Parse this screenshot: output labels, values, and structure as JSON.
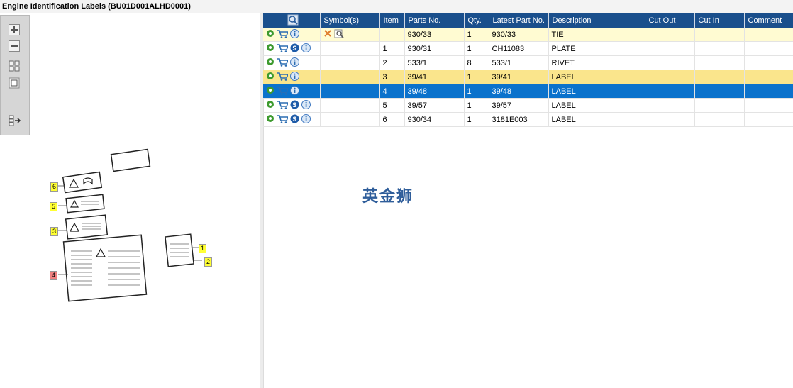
{
  "window": {
    "title": "Engine Identification Labels (BU01D001ALHD0001)"
  },
  "toolbar": {
    "tools": [
      "zoom-in-icon",
      "zoom-out-icon",
      "fit-all-icon",
      "fit-window-icon",
      "export-icon"
    ]
  },
  "drawing": {
    "callouts": [
      {
        "label": "6",
        "color": "yellow"
      },
      {
        "label": "5",
        "color": "yellow"
      },
      {
        "label": "3",
        "color": "yellow"
      },
      {
        "label": "4",
        "color": "red"
      },
      {
        "label": "1",
        "color": "yellow"
      },
      {
        "label": "2",
        "color": "yellow"
      }
    ]
  },
  "grid": {
    "columns": [
      "",
      "Symbol(s)",
      "Item",
      "Parts No.",
      "Qty.",
      "Latest Part No.",
      "Description",
      "Cut Out",
      "Cut In",
      "Comment"
    ],
    "rows": [
      {
        "style": "pale",
        "s_icon": false,
        "symbols": true,
        "item": "",
        "parts_no": "930/33",
        "qty": "1",
        "latest": "930/33",
        "desc": "TIE"
      },
      {
        "style": "",
        "s_icon": true,
        "symbols": false,
        "item": "1",
        "parts_no": "930/31",
        "qty": "1",
        "latest": "CH11083",
        "desc": "PLATE"
      },
      {
        "style": "",
        "s_icon": false,
        "symbols": false,
        "item": "2",
        "parts_no": "533/1",
        "qty": "8",
        "latest": "533/1",
        "desc": "RIVET"
      },
      {
        "style": "yellow",
        "s_icon": false,
        "symbols": false,
        "item": "3",
        "parts_no": "39/41",
        "qty": "1",
        "latest": "39/41",
        "desc": "LABEL"
      },
      {
        "style": "selected",
        "s_icon": false,
        "symbols": false,
        "item": "4",
        "parts_no": "39/48",
        "qty": "1",
        "latest": "39/48",
        "desc": "LABEL"
      },
      {
        "style": "",
        "s_icon": true,
        "symbols": false,
        "item": "5",
        "parts_no": "39/57",
        "qty": "1",
        "latest": "39/57",
        "desc": "LABEL"
      },
      {
        "style": "",
        "s_icon": true,
        "symbols": false,
        "item": "6",
        "parts_no": "930/34",
        "qty": "1",
        "latest": "3181E003",
        "desc": "LABEL"
      }
    ]
  },
  "watermark": "英金狮",
  "colors": {
    "header": "#1a4f8c",
    "selected": "#0b72cc",
    "highlight": "#fae58c",
    "pale": "#fffbd2"
  }
}
